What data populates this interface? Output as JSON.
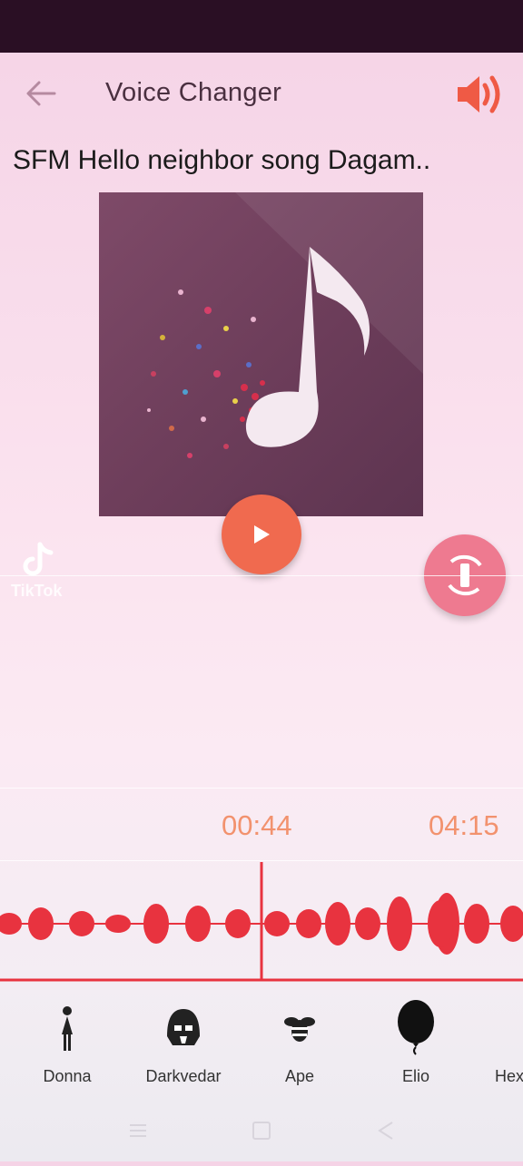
{
  "header": {
    "title": "Voice Changer"
  },
  "track": {
    "name": "SFM  Hello neighbor song  Dagam..",
    "current_time": "00:44",
    "total_time": "04:15",
    "progress": 0.173
  },
  "watermark": {
    "text": "TikTok"
  },
  "effects": [
    {
      "label": "Donna",
      "icon": "woman-icon"
    },
    {
      "label": "Darkvedar",
      "icon": "darth-helmet-icon"
    },
    {
      "label": "Ape",
      "icon": "bee-icon"
    },
    {
      "label": "Elio",
      "icon": "balloon-icon"
    },
    {
      "label": "Hexa",
      "icon": "hexa-icon"
    }
  ],
  "colors": {
    "accent": "#f06a4f",
    "waveform": "#e8333f",
    "time": "#f2926e",
    "rotate_button": "#ee7a90"
  }
}
